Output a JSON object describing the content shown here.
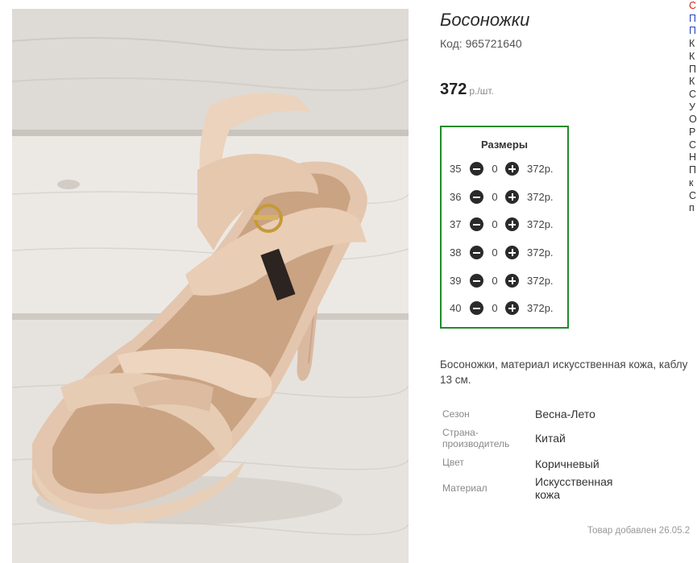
{
  "product": {
    "title": "Босоножки",
    "code_text": "Код: 965721640",
    "price_value": "372",
    "price_unit": "р./шт.",
    "image_alt": "sandal-photo"
  },
  "sizes": {
    "title": "Размеры",
    "rows": [
      {
        "size": "35",
        "qty": "0",
        "price": "372р."
      },
      {
        "size": "36",
        "qty": "0",
        "price": "372р."
      },
      {
        "size": "37",
        "qty": "0",
        "price": "372р."
      },
      {
        "size": "38",
        "qty": "0",
        "price": "372р."
      },
      {
        "size": "39",
        "qty": "0",
        "price": "372р."
      },
      {
        "size": "40",
        "qty": "0",
        "price": "372р."
      }
    ]
  },
  "description": {
    "line1": "Босоножки, материал искусственная кожа, каблу",
    "line2": "13 см."
  },
  "properties": [
    {
      "key": "Сезон",
      "value": "Весна-Лето"
    },
    {
      "key": "Страна-производитель",
      "value": "Китай"
    },
    {
      "key": "Цвет",
      "value": "Коричневый"
    },
    {
      "key": "Материал",
      "value": "Искусственная кожа"
    }
  ],
  "added_text": "Товар добавлен 26.05.2",
  "side_column": [
    {
      "text": "С",
      "style": "red"
    },
    {
      "text": "П",
      "style": "blue"
    },
    {
      "text": "П",
      "style": "blue"
    },
    {
      "text": "К",
      "style": "plain"
    },
    {
      "text": "К",
      "style": "plain"
    },
    {
      "text": "П",
      "style": "plain"
    },
    {
      "text": "К",
      "style": "plain"
    },
    {
      "text": "С",
      "style": "plain"
    },
    {
      "text": "У",
      "style": "plain"
    },
    {
      "text": "О",
      "style": "plain"
    },
    {
      "text": "Р",
      "style": "plain"
    },
    {
      "text": "С",
      "style": "plain"
    },
    {
      "text": "Н",
      "style": "plain"
    },
    {
      "text": "П",
      "style": "plain"
    },
    {
      "text": "к",
      "style": "plain"
    },
    {
      "text": "С",
      "style": "plain"
    },
    {
      "text": "п",
      "style": "plain"
    }
  ],
  "colors": {
    "sizes_border": "#1f8c2b",
    "link_red": "#d7261f",
    "link_blue": "#2b47c6"
  }
}
